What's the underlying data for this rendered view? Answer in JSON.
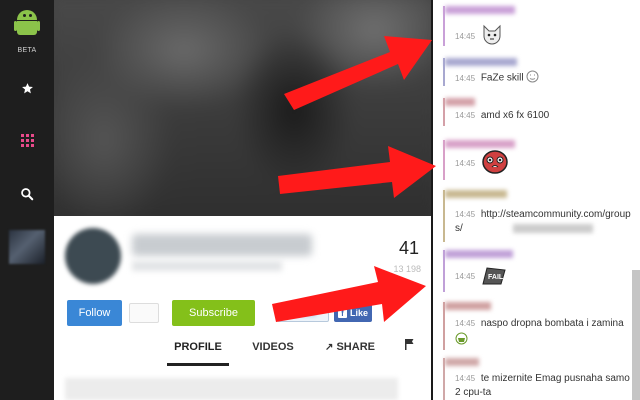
{
  "sidebar": {
    "logo_label": "BETA",
    "nav": [
      {
        "name": "favorites",
        "icon": "star-icon"
      },
      {
        "name": "browse",
        "icon": "grid-icon"
      },
      {
        "name": "search",
        "icon": "search-icon"
      }
    ]
  },
  "channel": {
    "follower_count": "41",
    "views_count": "13 198",
    "follow_label": "Follow",
    "subscribe_label": "Subscribe",
    "tweet_label": "Tweet",
    "like_label": "Like"
  },
  "tabs": [
    {
      "label": "PROFILE",
      "active": true
    },
    {
      "label": "VIDEOS",
      "active": false
    },
    {
      "label": "SHARE",
      "active": false
    }
  ],
  "chat": {
    "messages": [
      {
        "time": "14:45",
        "text": "",
        "emote": "cat-face-icon",
        "name_color": "#c9a0d8"
      },
      {
        "time": "14:45",
        "text": "FaZe skill",
        "emote": "smirk-icon",
        "name_color": "#a8a8d0"
      },
      {
        "time": "14:45",
        "text": "amd x6 fx 6100",
        "emote": "",
        "name_color": "#d4a0a8"
      },
      {
        "time": "14:45",
        "text": "",
        "emote": "blob-face-icon",
        "name_color": "#d8a0c8"
      },
      {
        "time": "14:45",
        "text": "http://steamcommunity.com/groups/",
        "emote": "",
        "name_color": "#c8b890"
      },
      {
        "time": "14:45",
        "text": "",
        "emote": "fail-stamp-icon",
        "name_color": "#c0a0d8"
      },
      {
        "time": "14:45",
        "text": "naspo dropna bombata i zamina",
        "emote": "bucket-icon",
        "name_color": "#d0a0a0"
      },
      {
        "time": "14:45",
        "text": "te mizernite Emag pusnaha samo 2 cpu-ta",
        "emote": "",
        "name_color": "#d0a8a8"
      }
    ]
  },
  "colors": {
    "follow_button": "#3a87d6",
    "subscribe_button": "#84c01a",
    "annotation_arrow": "#ff1a1a",
    "sidebar_bg": "#1e1e1e"
  }
}
